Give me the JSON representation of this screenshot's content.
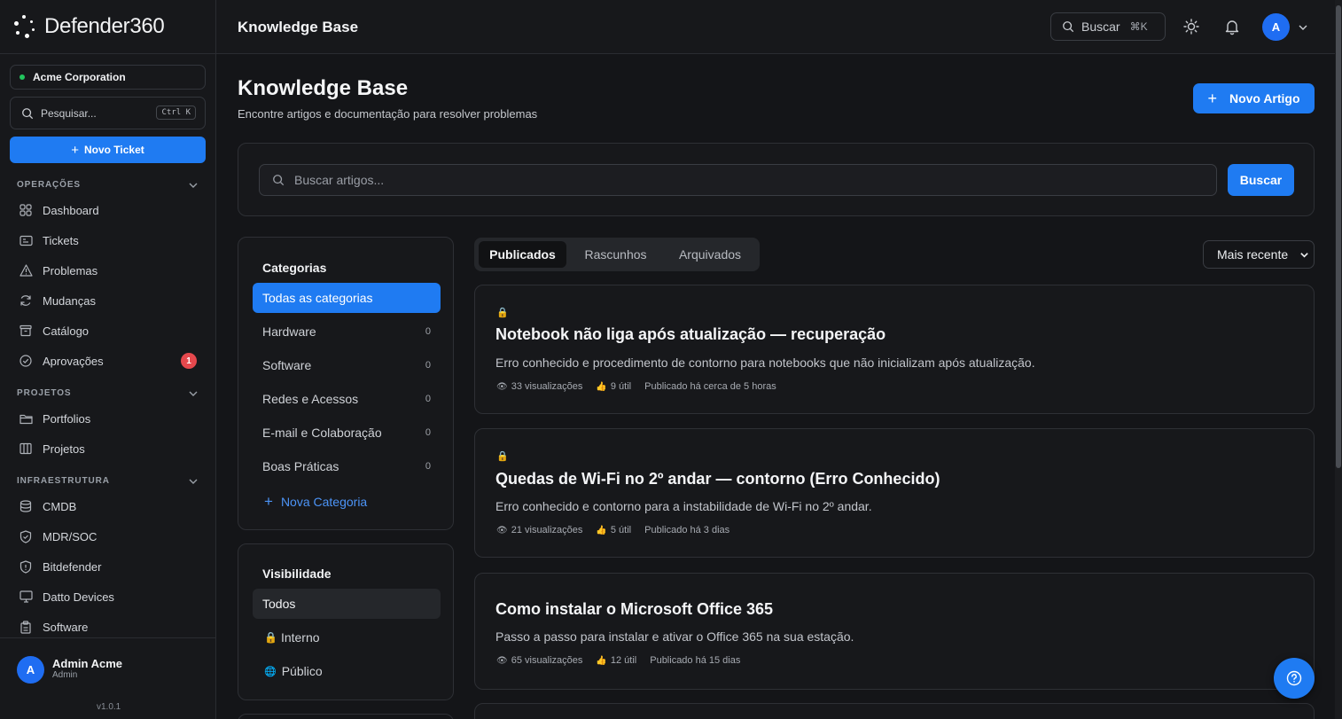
{
  "brand": {
    "name": "Defender360"
  },
  "sidebar": {
    "org": "Acme Corporation",
    "search_placeholder": "Pesquisar...",
    "search_shortcut": "Ctrl K",
    "new_ticket": "Novo Ticket",
    "sections": [
      {
        "title": "OPERAÇÕES",
        "items": [
          {
            "label": "Dashboard",
            "icon": "grid-icon"
          },
          {
            "label": "Tickets",
            "icon": "ticket-icon"
          },
          {
            "label": "Problemas",
            "icon": "warning-icon"
          },
          {
            "label": "Mudanças",
            "icon": "refresh-icon"
          },
          {
            "label": "Catálogo",
            "icon": "archive-icon"
          },
          {
            "label": "Aprovações",
            "icon": "check-circle-icon",
            "badge": "1"
          }
        ]
      },
      {
        "title": "PROJETOS",
        "items": [
          {
            "label": "Portfolios",
            "icon": "folder-icon"
          },
          {
            "label": "Projetos",
            "icon": "columns-icon"
          }
        ]
      },
      {
        "title": "INFRAESTRUTURA",
        "items": [
          {
            "label": "CMDB",
            "icon": "database-icon"
          },
          {
            "label": "MDR/SOC",
            "icon": "shield-check-icon"
          },
          {
            "label": "Bitdefender",
            "icon": "shield-icon"
          },
          {
            "label": "Datto Devices",
            "icon": "monitor-icon"
          },
          {
            "label": "Software",
            "icon": "package-icon"
          }
        ]
      }
    ],
    "user": {
      "initial": "A",
      "name": "Admin Acme",
      "role": "Admin"
    },
    "version": "v1.0.1"
  },
  "topbar": {
    "title": "Knowledge Base",
    "search_label": "Buscar",
    "search_shortcut": "⌘K",
    "avatar_initial": "A"
  },
  "page": {
    "title": "Knowledge Base",
    "subtitle": "Encontre artigos e documentação para resolver problemas",
    "new_article": "Novo Artigo",
    "search_placeholder": "Buscar artigos...",
    "search_button": "Buscar"
  },
  "categories": {
    "title": "Categorias",
    "all_label": "Todas as categorias",
    "items": [
      {
        "label": "Hardware",
        "count": "0"
      },
      {
        "label": "Software",
        "count": "0"
      },
      {
        "label": "Redes e Acessos",
        "count": "0"
      },
      {
        "label": "E-mail e Colaboração",
        "count": "0"
      },
      {
        "label": "Boas Práticas",
        "count": "0"
      }
    ],
    "new_category": "Nova Categoria"
  },
  "visibility": {
    "title": "Visibilidade",
    "items": [
      {
        "label": "Todos",
        "icon": ""
      },
      {
        "label": "Interno",
        "icon": "🔒"
      },
      {
        "label": "Público",
        "icon": "🌐"
      }
    ]
  },
  "tabs": [
    {
      "label": "Publicados",
      "active": true
    },
    {
      "label": "Rascunhos",
      "active": false
    },
    {
      "label": "Arquivados",
      "active": false
    }
  ],
  "sort": {
    "selected": "Mais recente"
  },
  "articles": [
    {
      "locked": true,
      "title": "Notebook não liga após atualização — recuperação",
      "description": "Erro conhecido e procedimento de contorno para notebooks que não inicializam após atualização.",
      "views": "33 visualizações",
      "helpful": "9 útil",
      "published": "Publicado há cerca de 5 horas"
    },
    {
      "locked": true,
      "title": "Quedas de Wi-Fi no 2º andar — contorno (Erro Conhecido)",
      "description": "Erro conhecido e contorno para a instabilidade de Wi-Fi no 2º andar.",
      "views": "21 visualizações",
      "helpful": "5 útil",
      "published": "Publicado há 3 dias"
    },
    {
      "locked": false,
      "title": "Como instalar o Microsoft Office 365",
      "description": "Passo a passo para instalar e ativar o Office 365 na sua estação.",
      "views": "65 visualizações",
      "helpful": "12 útil",
      "published": "Publicado há 15 dias"
    }
  ],
  "colors": {
    "accent": "#1f7bf2",
    "danger": "#e5484d",
    "online": "#22c55e"
  }
}
